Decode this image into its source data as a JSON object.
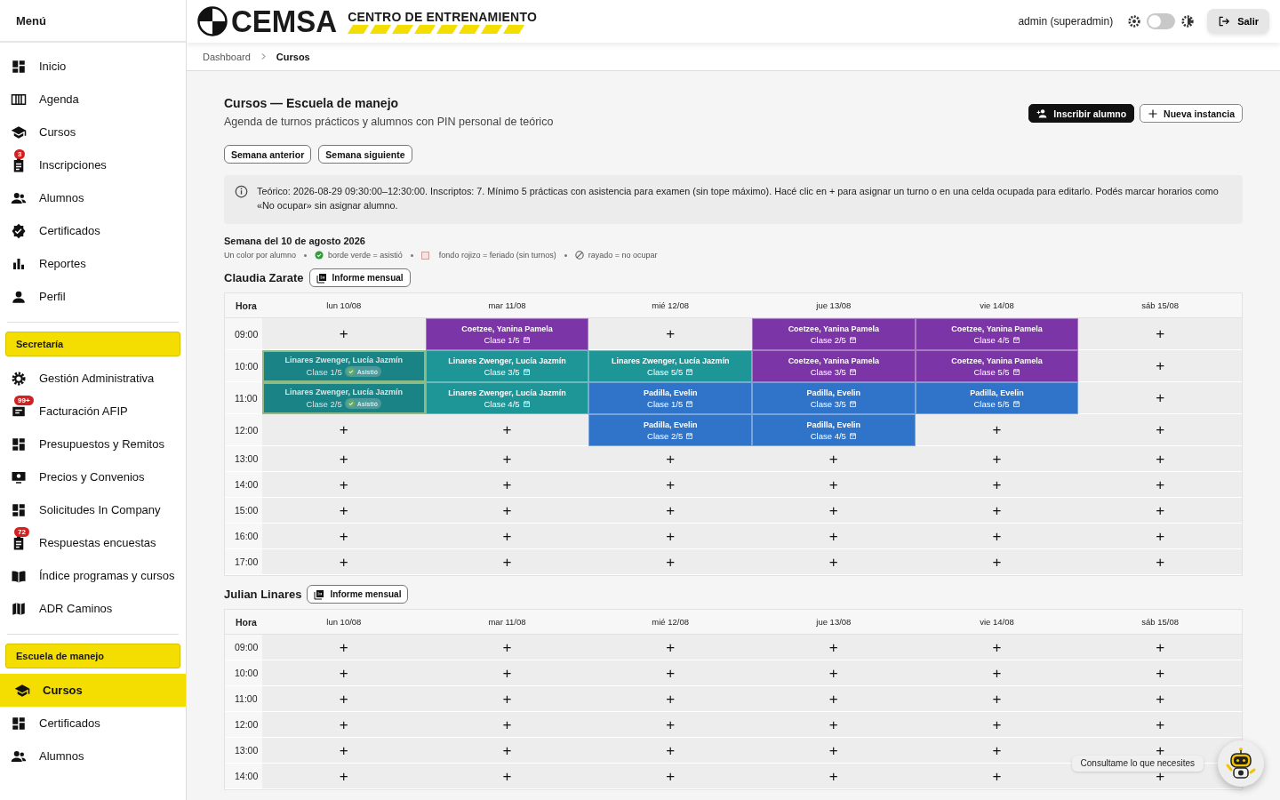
{
  "sidebar": {
    "title": "Menú",
    "groups": [
      {
        "items": [
          {
            "label": "Inicio",
            "selected": false
          },
          {
            "label": "Agenda",
            "selected": false
          },
          {
            "label": "Cursos",
            "selected": false
          },
          {
            "label": "Inscripciones",
            "badge": "3",
            "selected": false
          },
          {
            "label": "Alumnos",
            "selected": false
          },
          {
            "label": "Certificados",
            "selected": false
          },
          {
            "label": "Reportes",
            "selected": false
          },
          {
            "label": "Perfil",
            "selected": false
          }
        ]
      },
      {
        "header": "Secretaría",
        "items": [
          {
            "label": "Gestión Administrativa",
            "selected": false
          },
          {
            "label": "Facturación AFIP",
            "badge": "99+",
            "selected": false
          },
          {
            "label": "Presupuestos y Remitos",
            "selected": false
          },
          {
            "label": "Precios y Convenios",
            "selected": false
          },
          {
            "label": "Solicitudes In Company",
            "selected": false
          },
          {
            "label": "Respuestas encuestas",
            "badge": "72",
            "selected": false
          },
          {
            "label": "Índice programas y cursos",
            "selected": false
          },
          {
            "label": "ADR Caminos",
            "selected": false
          }
        ]
      },
      {
        "header": "Escuela de manejo",
        "items": [
          {
            "label": "Cursos",
            "selected": true
          },
          {
            "label": "Certificados",
            "selected": false
          },
          {
            "label": "Alumnos",
            "selected": false
          }
        ]
      }
    ]
  },
  "header": {
    "logo_text": "CEMSA",
    "logo_subtitle": "CENTRO DE ENTRENAMIENTO",
    "user": "admin (superadmin)",
    "dark_mode": false,
    "logout": "Salir"
  },
  "breadcrumb": [
    "Dashboard",
    "Cursos"
  ],
  "page": {
    "title": "Cursos — Escuela de manejo",
    "subtitle": "Agenda de turnos prácticos y alumnos con PIN personal de teórico",
    "actions": [
      {
        "label": "Inscribir alumno",
        "kind": "primary"
      },
      {
        "label": "Nueva instancia",
        "kind": "secondary"
      }
    ],
    "week_buttons": [
      "Semana anterior",
      "Semana siguiente"
    ],
    "info": "Teórico: 2026-08-29 09:30:00–12:30:00. Inscriptos: 7. Mínimo 5 prácticas con asistencia para examen (sin tope máximo). Hacé clic en + para asignar un turno o en una celda ocupada para editarlo. Podés marcar horarios como «No ocupar» sin asignar alumno.",
    "week_label": "Semana del 10 de agosto 2026",
    "legend": [
      {
        "kind": "plain",
        "text": "Un color por alumno"
      },
      {
        "kind": "check",
        "text": "borde verde = asistió"
      },
      {
        "kind": "holiday",
        "text": "fondo rojizo = feriado (sin turnos)"
      },
      {
        "kind": "blocked",
        "text": "rayado = no ocupar"
      }
    ]
  },
  "schedules": [
    {
      "instructor": "Claudia Zarate",
      "report_button": "Informe mensual",
      "hour_header": "Hora",
      "days": [
        "lun 10/08",
        "mar 11/08",
        "mié 12/08",
        "jue 13/08",
        "vie 14/08",
        "sáb 15/08"
      ],
      "rows": [
        {
          "hour": "09:00",
          "cells": [
            {
              "kind": "empty",
              "text": "+"
            },
            {
              "kind": "booking",
              "student": "Coetzee, Yanina Pamela",
              "lesson": "Clase 1/5",
              "color": "#7b35a6",
              "attended": false
            },
            {
              "kind": "empty",
              "text": "+"
            },
            {
              "kind": "booking",
              "student": "Coetzee, Yanina Pamela",
              "lesson": "Clase 2/5",
              "color": "#7b35a6",
              "attended": false
            },
            {
              "kind": "booking",
              "student": "Coetzee, Yanina Pamela",
              "lesson": "Clase 4/5",
              "color": "#7b35a6",
              "attended": false
            },
            {
              "kind": "empty",
              "text": "+"
            }
          ]
        },
        {
          "hour": "10:00",
          "cells": [
            {
              "kind": "booking",
              "student": "Linares Zwenger, Lucía Jazmín",
              "lesson": "Clase 1/5",
              "color": "#1e9597",
              "attended": true,
              "badge": "Asistió"
            },
            {
              "kind": "booking",
              "student": "Linares Zwenger, Lucía Jazmín",
              "lesson": "Clase 3/5",
              "color": "#1e9597",
              "attended": false
            },
            {
              "kind": "booking",
              "student": "Linares Zwenger, Lucía Jazmín",
              "lesson": "Clase 5/5",
              "color": "#1e9597",
              "attended": false
            },
            {
              "kind": "booking",
              "student": "Coetzee, Yanina Pamela",
              "lesson": "Clase 3/5",
              "color": "#7b35a6",
              "attended": false
            },
            {
              "kind": "booking",
              "student": "Coetzee, Yanina Pamela",
              "lesson": "Clase 5/5",
              "color": "#7b35a6",
              "attended": false
            },
            {
              "kind": "empty",
              "text": "+"
            }
          ]
        },
        {
          "hour": "11:00",
          "cells": [
            {
              "kind": "booking",
              "student": "Linares Zwenger, Lucía Jazmín",
              "lesson": "Clase 2/5",
              "color": "#1e9597",
              "attended": true,
              "badge": "Asistió"
            },
            {
              "kind": "booking",
              "student": "Linares Zwenger, Lucía Jazmín",
              "lesson": "Clase 4/5",
              "color": "#1e9597",
              "attended": false
            },
            {
              "kind": "booking",
              "student": "Padilla, Evelin",
              "lesson": "Clase 1/5",
              "color": "#2f74c8",
              "attended": false
            },
            {
              "kind": "booking",
              "student": "Padilla, Evelin",
              "lesson": "Clase 3/5",
              "color": "#2f74c8",
              "attended": false
            },
            {
              "kind": "booking",
              "student": "Padilla, Evelin",
              "lesson": "Clase 5/5",
              "color": "#2f74c8",
              "attended": false
            },
            {
              "kind": "empty",
              "text": "+"
            }
          ]
        },
        {
          "hour": "12:00",
          "cells": [
            {
              "kind": "empty",
              "text": "+"
            },
            {
              "kind": "empty",
              "text": "+"
            },
            {
              "kind": "booking",
              "student": "Padilla, Evelin",
              "lesson": "Clase 2/5",
              "color": "#2f74c8",
              "attended": false
            },
            {
              "kind": "booking",
              "student": "Padilla, Evelin",
              "lesson": "Clase 4/5",
              "color": "#2f74c8",
              "attended": false
            },
            {
              "kind": "empty",
              "text": "+"
            },
            {
              "kind": "empty",
              "text": "+"
            }
          ]
        },
        {
          "hour": "13:00",
          "cells": [
            {
              "kind": "empty",
              "text": "+"
            },
            {
              "kind": "empty",
              "text": "+"
            },
            {
              "kind": "empty",
              "text": "+"
            },
            {
              "kind": "empty",
              "text": "+"
            },
            {
              "kind": "empty",
              "text": "+"
            },
            {
              "kind": "empty",
              "text": "+"
            }
          ]
        },
        {
          "hour": "14:00",
          "cells": [
            {
              "kind": "empty",
              "text": "+"
            },
            {
              "kind": "empty",
              "text": "+"
            },
            {
              "kind": "empty",
              "text": "+"
            },
            {
              "kind": "empty",
              "text": "+"
            },
            {
              "kind": "empty",
              "text": "+"
            },
            {
              "kind": "empty",
              "text": "+"
            }
          ]
        },
        {
          "hour": "15:00",
          "cells": [
            {
              "kind": "empty",
              "text": "+"
            },
            {
              "kind": "empty",
              "text": "+"
            },
            {
              "kind": "empty",
              "text": "+"
            },
            {
              "kind": "empty",
              "text": "+"
            },
            {
              "kind": "empty",
              "text": "+"
            },
            {
              "kind": "empty",
              "text": "+"
            }
          ]
        },
        {
          "hour": "16:00",
          "cells": [
            {
              "kind": "empty",
              "text": "+"
            },
            {
              "kind": "empty",
              "text": "+"
            },
            {
              "kind": "empty",
              "text": "+"
            },
            {
              "kind": "empty",
              "text": "+"
            },
            {
              "kind": "empty",
              "text": "+"
            },
            {
              "kind": "empty",
              "text": "+"
            }
          ]
        },
        {
          "hour": "17:00",
          "cells": [
            {
              "kind": "empty",
              "text": "+"
            },
            {
              "kind": "empty",
              "text": "+"
            },
            {
              "kind": "empty",
              "text": "+"
            },
            {
              "kind": "empty",
              "text": "+"
            },
            {
              "kind": "empty",
              "text": "+"
            },
            {
              "kind": "empty",
              "text": "+"
            }
          ]
        }
      ]
    },
    {
      "instructor": "Julian Linares",
      "report_button": "Informe mensual",
      "hour_header": "Hora",
      "days": [
        "lun 10/08",
        "mar 11/08",
        "mié 12/08",
        "jue 13/08",
        "vie 14/08",
        "sáb 15/08"
      ],
      "rows": [
        {
          "hour": "09:00",
          "cells": [
            {
              "kind": "empty",
              "text": "+"
            },
            {
              "kind": "empty",
              "text": "+"
            },
            {
              "kind": "empty",
              "text": "+"
            },
            {
              "kind": "empty",
              "text": "+"
            },
            {
              "kind": "empty",
              "text": "+"
            },
            {
              "kind": "empty",
              "text": "+"
            }
          ]
        },
        {
          "hour": "10:00",
          "cells": [
            {
              "kind": "empty",
              "text": "+"
            },
            {
              "kind": "empty",
              "text": "+"
            },
            {
              "kind": "empty",
              "text": "+"
            },
            {
              "kind": "empty",
              "text": "+"
            },
            {
              "kind": "empty",
              "text": "+"
            },
            {
              "kind": "empty",
              "text": "+"
            }
          ]
        },
        {
          "hour": "11:00",
          "cells": [
            {
              "kind": "empty",
              "text": "+"
            },
            {
              "kind": "empty",
              "text": "+"
            },
            {
              "kind": "empty",
              "text": "+"
            },
            {
              "kind": "empty",
              "text": "+"
            },
            {
              "kind": "empty",
              "text": "+"
            },
            {
              "kind": "empty",
              "text": "+"
            }
          ]
        },
        {
          "hour": "12:00",
          "cells": [
            {
              "kind": "empty",
              "text": "+"
            },
            {
              "kind": "empty",
              "text": "+"
            },
            {
              "kind": "empty",
              "text": "+"
            },
            {
              "kind": "empty",
              "text": "+"
            },
            {
              "kind": "empty",
              "text": "+"
            },
            {
              "kind": "empty",
              "text": "+"
            }
          ]
        },
        {
          "hour": "13:00",
          "cells": [
            {
              "kind": "empty",
              "text": "+"
            },
            {
              "kind": "empty",
              "text": "+"
            },
            {
              "kind": "empty",
              "text": "+"
            },
            {
              "kind": "empty",
              "text": "+"
            },
            {
              "kind": "empty",
              "text": "+"
            },
            {
              "kind": "empty",
              "text": "+"
            }
          ]
        },
        {
          "hour": "14:00",
          "cells": [
            {
              "kind": "empty",
              "text": "+"
            },
            {
              "kind": "empty",
              "text": "+"
            },
            {
              "kind": "empty",
              "text": "+"
            },
            {
              "kind": "empty",
              "text": "+"
            },
            {
              "kind": "empty",
              "text": "+"
            },
            {
              "kind": "empty",
              "text": "+"
            }
          ]
        }
      ]
    }
  ],
  "assistant": {
    "tooltip": "Consultame lo que necesites"
  }
}
